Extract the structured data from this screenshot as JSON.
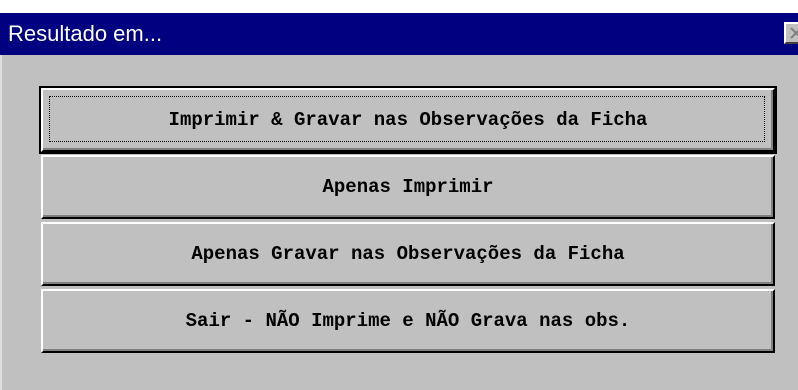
{
  "window": {
    "title": "Resultado em...",
    "close_icon": "close-icon"
  },
  "buttons": [
    {
      "label": "Imprimir & Gravar nas Observações da Ficha",
      "default": true
    },
    {
      "label": "Apenas Imprimir",
      "default": false
    },
    {
      "label": "Apenas Gravar nas Observações da Ficha",
      "default": false
    },
    {
      "label": "Sair - NÃO Imprime e NÃO Grava nas obs.",
      "default": false
    }
  ]
}
